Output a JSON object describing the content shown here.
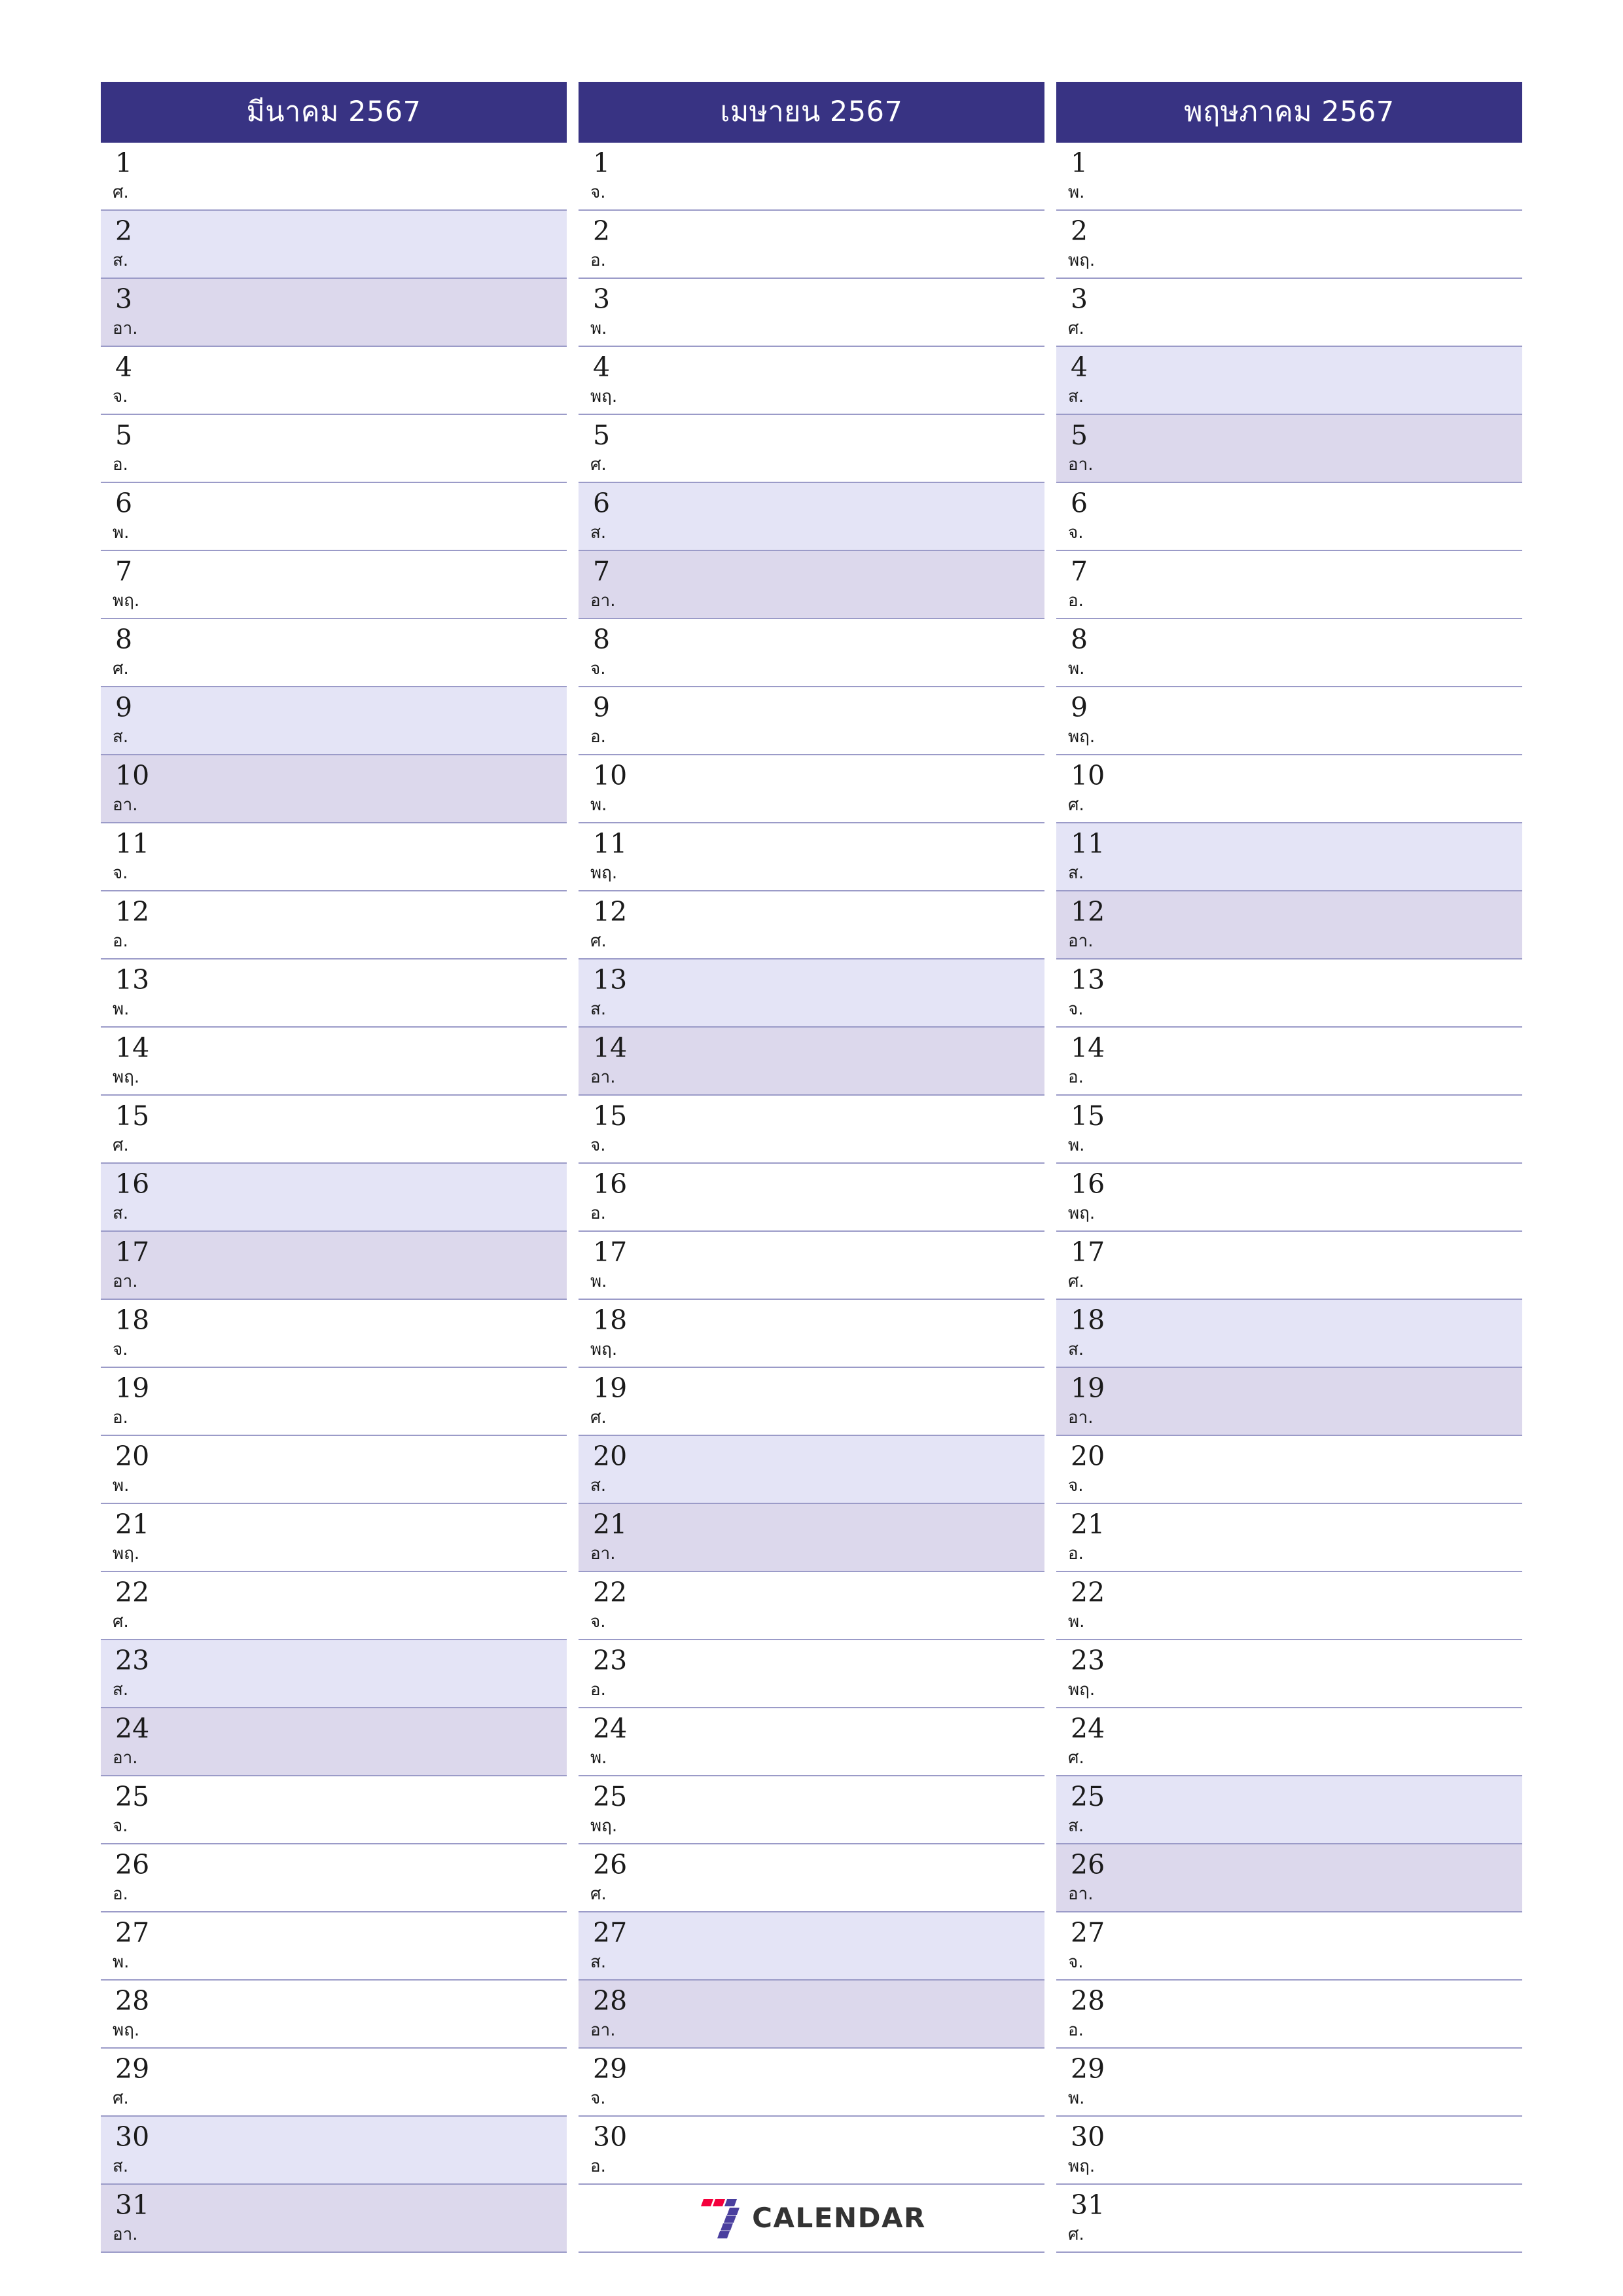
{
  "page": {
    "background": "#ffffff",
    "accent": "#383383",
    "rule_color": "#9b9bc8",
    "saturday_color": "#e4e4f6",
    "sunday_color": "#dcd8ec"
  },
  "brand": {
    "name": "CALENDAR",
    "mark": "seven-logo-mark",
    "mark_red": "#f4003c",
    "mark_purple": "#4a3f9e"
  },
  "weekday_labels": {
    "mon": "จ.",
    "tue": "อ.",
    "wed": "พ.",
    "thu": "พฤ.",
    "fri": "ศ.",
    "sat": "ส.",
    "sun": "อา."
  },
  "months": [
    {
      "title": "มีนาคม 2567",
      "name": "march",
      "days": [
        {
          "n": "1",
          "wd": "ศ.",
          "type": "weekday"
        },
        {
          "n": "2",
          "wd": "ส.",
          "type": "sat"
        },
        {
          "n": "3",
          "wd": "อา.",
          "type": "sun"
        },
        {
          "n": "4",
          "wd": "จ.",
          "type": "weekday"
        },
        {
          "n": "5",
          "wd": "อ.",
          "type": "weekday"
        },
        {
          "n": "6",
          "wd": "พ.",
          "type": "weekday"
        },
        {
          "n": "7",
          "wd": "พฤ.",
          "type": "weekday"
        },
        {
          "n": "8",
          "wd": "ศ.",
          "type": "weekday"
        },
        {
          "n": "9",
          "wd": "ส.",
          "type": "sat"
        },
        {
          "n": "10",
          "wd": "อา.",
          "type": "sun"
        },
        {
          "n": "11",
          "wd": "จ.",
          "type": "weekday"
        },
        {
          "n": "12",
          "wd": "อ.",
          "type": "weekday"
        },
        {
          "n": "13",
          "wd": "พ.",
          "type": "weekday"
        },
        {
          "n": "14",
          "wd": "พฤ.",
          "type": "weekday"
        },
        {
          "n": "15",
          "wd": "ศ.",
          "type": "weekday"
        },
        {
          "n": "16",
          "wd": "ส.",
          "type": "sat"
        },
        {
          "n": "17",
          "wd": "อา.",
          "type": "sun"
        },
        {
          "n": "18",
          "wd": "จ.",
          "type": "weekday"
        },
        {
          "n": "19",
          "wd": "อ.",
          "type": "weekday"
        },
        {
          "n": "20",
          "wd": "พ.",
          "type": "weekday"
        },
        {
          "n": "21",
          "wd": "พฤ.",
          "type": "weekday"
        },
        {
          "n": "22",
          "wd": "ศ.",
          "type": "weekday"
        },
        {
          "n": "23",
          "wd": "ส.",
          "type": "sat"
        },
        {
          "n": "24",
          "wd": "อา.",
          "type": "sun"
        },
        {
          "n": "25",
          "wd": "จ.",
          "type": "weekday"
        },
        {
          "n": "26",
          "wd": "อ.",
          "type": "weekday"
        },
        {
          "n": "27",
          "wd": "พ.",
          "type": "weekday"
        },
        {
          "n": "28",
          "wd": "พฤ.",
          "type": "weekday"
        },
        {
          "n": "29",
          "wd": "ศ.",
          "type": "weekday"
        },
        {
          "n": "30",
          "wd": "ส.",
          "type": "sat"
        },
        {
          "n": "31",
          "wd": "อา.",
          "type": "sun"
        }
      ]
    },
    {
      "title": "เมษายน 2567",
      "name": "april",
      "days": [
        {
          "n": "1",
          "wd": "จ.",
          "type": "weekday"
        },
        {
          "n": "2",
          "wd": "อ.",
          "type": "weekday"
        },
        {
          "n": "3",
          "wd": "พ.",
          "type": "weekday"
        },
        {
          "n": "4",
          "wd": "พฤ.",
          "type": "weekday"
        },
        {
          "n": "5",
          "wd": "ศ.",
          "type": "weekday"
        },
        {
          "n": "6",
          "wd": "ส.",
          "type": "sat"
        },
        {
          "n": "7",
          "wd": "อา.",
          "type": "sun"
        },
        {
          "n": "8",
          "wd": "จ.",
          "type": "weekday"
        },
        {
          "n": "9",
          "wd": "อ.",
          "type": "weekday"
        },
        {
          "n": "10",
          "wd": "พ.",
          "type": "weekday"
        },
        {
          "n": "11",
          "wd": "พฤ.",
          "type": "weekday"
        },
        {
          "n": "12",
          "wd": "ศ.",
          "type": "weekday"
        },
        {
          "n": "13",
          "wd": "ส.",
          "type": "sat"
        },
        {
          "n": "14",
          "wd": "อา.",
          "type": "sun"
        },
        {
          "n": "15",
          "wd": "จ.",
          "type": "weekday"
        },
        {
          "n": "16",
          "wd": "อ.",
          "type": "weekday"
        },
        {
          "n": "17",
          "wd": "พ.",
          "type": "weekday"
        },
        {
          "n": "18",
          "wd": "พฤ.",
          "type": "weekday"
        },
        {
          "n": "19",
          "wd": "ศ.",
          "type": "weekday"
        },
        {
          "n": "20",
          "wd": "ส.",
          "type": "sat"
        },
        {
          "n": "21",
          "wd": "อา.",
          "type": "sun"
        },
        {
          "n": "22",
          "wd": "จ.",
          "type": "weekday"
        },
        {
          "n": "23",
          "wd": "อ.",
          "type": "weekday"
        },
        {
          "n": "24",
          "wd": "พ.",
          "type": "weekday"
        },
        {
          "n": "25",
          "wd": "พฤ.",
          "type": "weekday"
        },
        {
          "n": "26",
          "wd": "ศ.",
          "type": "weekday"
        },
        {
          "n": "27",
          "wd": "ส.",
          "type": "sat"
        },
        {
          "n": "28",
          "wd": "อา.",
          "type": "sun"
        },
        {
          "n": "29",
          "wd": "จ.",
          "type": "weekday"
        },
        {
          "n": "30",
          "wd": "อ.",
          "type": "weekday"
        },
        {
          "n": "",
          "wd": "",
          "type": "logo"
        }
      ]
    },
    {
      "title": "พฤษภาคม 2567",
      "name": "may",
      "days": [
        {
          "n": "1",
          "wd": "พ.",
          "type": "weekday"
        },
        {
          "n": "2",
          "wd": "พฤ.",
          "type": "weekday"
        },
        {
          "n": "3",
          "wd": "ศ.",
          "type": "weekday"
        },
        {
          "n": "4",
          "wd": "ส.",
          "type": "sat"
        },
        {
          "n": "5",
          "wd": "อา.",
          "type": "sun"
        },
        {
          "n": "6",
          "wd": "จ.",
          "type": "weekday"
        },
        {
          "n": "7",
          "wd": "อ.",
          "type": "weekday"
        },
        {
          "n": "8",
          "wd": "พ.",
          "type": "weekday"
        },
        {
          "n": "9",
          "wd": "พฤ.",
          "type": "weekday"
        },
        {
          "n": "10",
          "wd": "ศ.",
          "type": "weekday"
        },
        {
          "n": "11",
          "wd": "ส.",
          "type": "sat"
        },
        {
          "n": "12",
          "wd": "อา.",
          "type": "sun"
        },
        {
          "n": "13",
          "wd": "จ.",
          "type": "weekday"
        },
        {
          "n": "14",
          "wd": "อ.",
          "type": "weekday"
        },
        {
          "n": "15",
          "wd": "พ.",
          "type": "weekday"
        },
        {
          "n": "16",
          "wd": "พฤ.",
          "type": "weekday"
        },
        {
          "n": "17",
          "wd": "ศ.",
          "type": "weekday"
        },
        {
          "n": "18",
          "wd": "ส.",
          "type": "sat"
        },
        {
          "n": "19",
          "wd": "อา.",
          "type": "sun"
        },
        {
          "n": "20",
          "wd": "จ.",
          "type": "weekday"
        },
        {
          "n": "21",
          "wd": "อ.",
          "type": "weekday"
        },
        {
          "n": "22",
          "wd": "พ.",
          "type": "weekday"
        },
        {
          "n": "23",
          "wd": "พฤ.",
          "type": "weekday"
        },
        {
          "n": "24",
          "wd": "ศ.",
          "type": "weekday"
        },
        {
          "n": "25",
          "wd": "ส.",
          "type": "sat"
        },
        {
          "n": "26",
          "wd": "อา.",
          "type": "sun"
        },
        {
          "n": "27",
          "wd": "จ.",
          "type": "weekday"
        },
        {
          "n": "28",
          "wd": "อ.",
          "type": "weekday"
        },
        {
          "n": "29",
          "wd": "พ.",
          "type": "weekday"
        },
        {
          "n": "30",
          "wd": "พฤ.",
          "type": "weekday"
        },
        {
          "n": "31",
          "wd": "ศ.",
          "type": "weekday"
        }
      ]
    }
  ]
}
